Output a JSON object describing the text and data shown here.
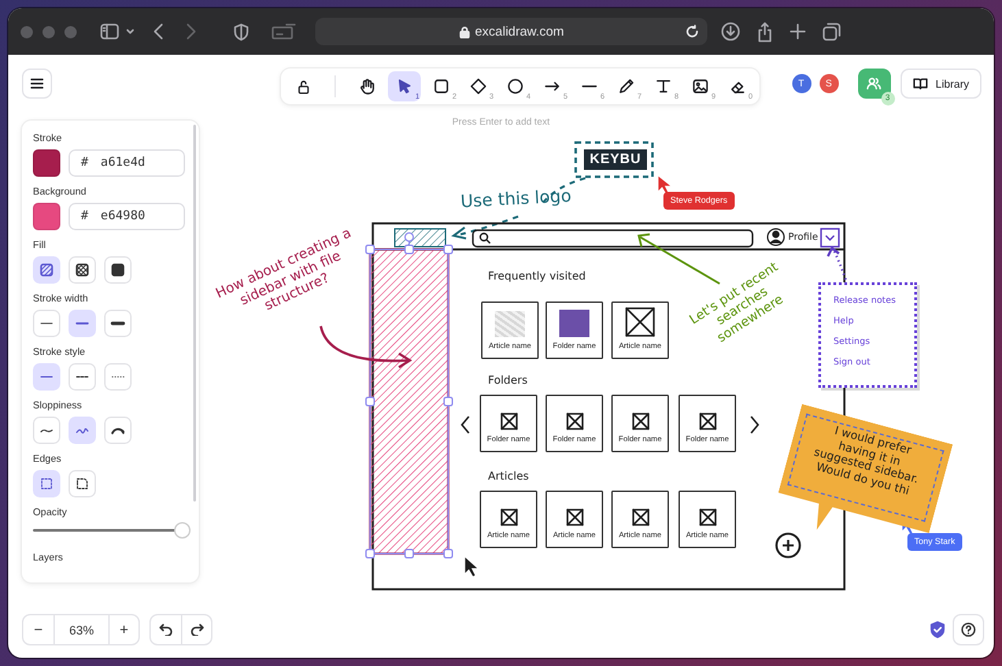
{
  "browser": {
    "url": "excalidraw.com"
  },
  "toolbar": {
    "tools": [
      {
        "kind": "hand",
        "selected": false
      },
      {
        "kind": "selection",
        "shortcut": "1",
        "selected": true
      },
      {
        "kind": "rectangle",
        "shortcut": "2",
        "selected": false
      },
      {
        "kind": "diamond",
        "shortcut": "3",
        "selected": false
      },
      {
        "kind": "ellipse",
        "shortcut": "4",
        "selected": false
      },
      {
        "kind": "arrow",
        "shortcut": "5",
        "selected": false
      },
      {
        "kind": "line",
        "shortcut": "6",
        "selected": false
      },
      {
        "kind": "pencil",
        "shortcut": "7",
        "selected": false
      },
      {
        "kind": "text",
        "shortcut": "8",
        "selected": false
      },
      {
        "kind": "image",
        "shortcut": "9",
        "selected": false
      },
      {
        "kind": "eraser",
        "shortcut": "0",
        "selected": false
      }
    ]
  },
  "collaborators": [
    {
      "initial": "T",
      "color": "#4a6ee0"
    },
    {
      "initial": "S",
      "color": "#e5534b"
    }
  ],
  "share": {
    "count": "3"
  },
  "library": {
    "label": "Library"
  },
  "hint": "Press Enter to add text",
  "properties": {
    "colors": [
      {
        "label": "Stroke",
        "prefix": "#",
        "value": "a61e4d"
      },
      {
        "label": "Background",
        "prefix": "#",
        "value": "e64980"
      }
    ],
    "groups": [
      {
        "label": "Fill",
        "options": [
          {
            "kind": "hachure",
            "selected": true
          },
          {
            "kind": "cross-hatch",
            "selected": false
          },
          {
            "kind": "solid",
            "selected": false
          }
        ]
      },
      {
        "label": "Stroke width",
        "options": [
          {
            "kind": "thin",
            "selected": false
          },
          {
            "kind": "bold",
            "selected": true
          },
          {
            "kind": "extra-bold",
            "selected": false
          }
        ]
      },
      {
        "label": "Stroke style",
        "options": [
          {
            "kind": "line-solid",
            "selected": true
          },
          {
            "kind": "line-dashed",
            "selected": false
          },
          {
            "kind": "line-dotted",
            "selected": false
          }
        ]
      },
      {
        "label": "Sloppiness",
        "options": [
          {
            "kind": "architect",
            "selected": false
          },
          {
            "kind": "artist",
            "selected": true
          },
          {
            "kind": "cartoonist",
            "selected": false
          }
        ]
      },
      {
        "label": "Edges",
        "options": [
          {
            "kind": "sharp",
            "selected": true
          },
          {
            "kind": "round",
            "selected": false
          }
        ]
      }
    ],
    "opacity": {
      "label": "Opacity",
      "level": 0.97
    },
    "layers": {
      "label": "Layers"
    }
  },
  "zoom": {
    "out": "−",
    "value": "63%",
    "in": "+"
  },
  "canvas": {
    "logo": {
      "text": "KEYBU"
    },
    "collaborator_labels": [
      {
        "name": "Steve Rodgers",
        "color": "#e03131"
      },
      {
        "name": "Tony Stark",
        "color": "#4c6ef5"
      }
    ],
    "notes": [
      {
        "text": "Use this logo",
        "color": "#1c6a78"
      },
      {
        "text": "How about creating a sidebar with file structure?",
        "color": "#a61e4d"
      },
      {
        "text": "Let's put recent searches somewhere",
        "color": "#5c940d"
      }
    ],
    "wireframe": {
      "profile": "Profile",
      "sections": [
        {
          "title": "Frequently visited",
          "carousel": false,
          "cards": [
            {
              "kind": "texture",
              "label": "Article name"
            },
            {
              "kind": "photo",
              "label": "Folder name"
            },
            {
              "kind": "placeholder-large",
              "label": "Article name"
            }
          ]
        },
        {
          "title": "Folders",
          "carousel": true,
          "cards": [
            {
              "kind": "placeholder",
              "label": "Folder name"
            },
            {
              "kind": "placeholder",
              "label": "Folder name"
            },
            {
              "kind": "placeholder",
              "label": "Folder name"
            },
            {
              "kind": "placeholder",
              "label": "Folder name"
            }
          ]
        },
        {
          "title": "Articles",
          "carousel": false,
          "cards": [
            {
              "kind": "placeholder",
              "label": "Article name"
            },
            {
              "kind": "placeholder",
              "label": "Article name"
            },
            {
              "kind": "placeholder",
              "label": "Article name"
            },
            {
              "kind": "placeholder",
              "label": "Article name"
            }
          ]
        }
      ]
    },
    "menu": [
      "Release notes",
      "Help",
      "Settings",
      "Sign out"
    ],
    "sticky": {
      "text": "I would prefer having it in suggested sidebar. Would do you thi"
    }
  }
}
